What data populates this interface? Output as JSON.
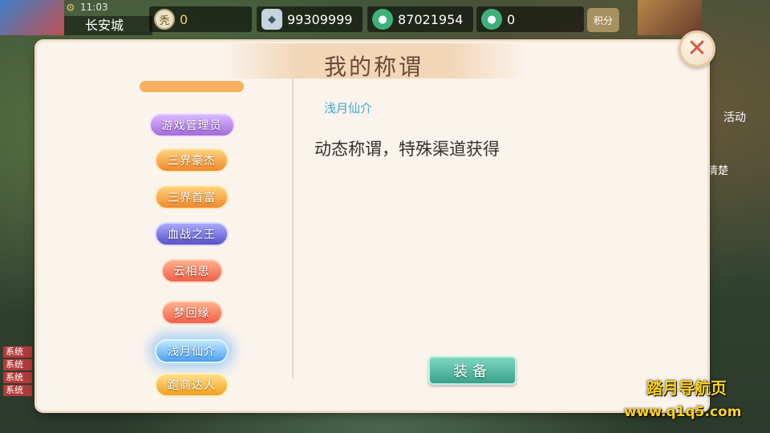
{
  "status": {
    "time": "11:03",
    "city": "长安城"
  },
  "resources": [
    {
      "icon": "gold-coin-icon",
      "glyph": "秃",
      "value": "0"
    },
    {
      "icon": "silver-ingot-icon",
      "glyph": "◆",
      "value": "99309999"
    },
    {
      "icon": "jade-icon",
      "glyph": "●",
      "value": "87021954"
    },
    {
      "icon": "jade-icon",
      "glyph": "●",
      "value": "0"
    }
  ],
  "score_button": "积分",
  "side_right": {
    "activity": "活动",
    "clear": "清楚"
  },
  "chat_tags": [
    "系统",
    "系统",
    "系统",
    "系统"
  ],
  "modal": {
    "title": "我的称谓",
    "titles": [
      "游戏管理员",
      "三界豪杰",
      "三界首富",
      "血战之王",
      "云相思",
      "梦回缘",
      "浅月仙介",
      "跑商达人"
    ],
    "selected": {
      "name": "浅月仙介",
      "description": "动态称谓，特殊渠道获得"
    },
    "equip_label": "装备"
  },
  "watermark": {
    "line1": "踏月导航页",
    "line2": "www.q1q5.com"
  },
  "colors": {
    "accent_blue": "#42a8d8",
    "equip_green": "#3aa08a",
    "close_red": "#e0543e"
  }
}
